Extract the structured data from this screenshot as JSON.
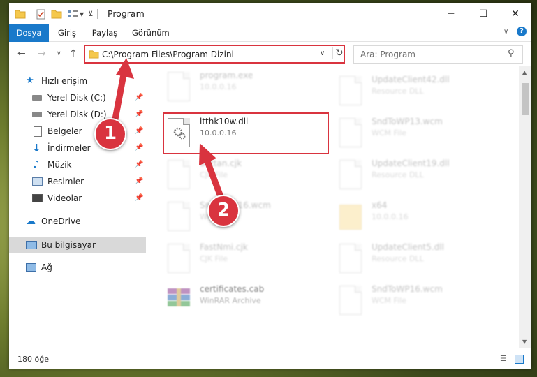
{
  "window": {
    "title": "Program",
    "minimize_icon": "─",
    "maximize_icon": "☐",
    "close_icon": "✕"
  },
  "ribbon": {
    "tabs": [
      "Dosya",
      "Giriş",
      "Paylaş",
      "Görünüm"
    ]
  },
  "address": {
    "path": "C:\\Program Files\\Program Dizini"
  },
  "search": {
    "placeholder": "Ara: Program"
  },
  "sidebar": {
    "items": [
      {
        "label": "Hızlı erişim",
        "icon": "star-icon",
        "pinned": false
      },
      {
        "label": "Yerel Disk (C:)",
        "icon": "drive-icon",
        "pinned": true
      },
      {
        "label": "Yerel Disk (D:)",
        "icon": "drive-icon",
        "pinned": true
      },
      {
        "label": "Belgeler",
        "icon": "document-icon",
        "pinned": true
      },
      {
        "label": "İndirmeler",
        "icon": "download-icon",
        "pinned": true
      },
      {
        "label": "Müzik",
        "icon": "music-icon",
        "pinned": true
      },
      {
        "label": "Resimler",
        "icon": "pictures-icon",
        "pinned": true
      },
      {
        "label": "Videolar",
        "icon": "video-icon",
        "pinned": true
      },
      {
        "label": "OneDrive",
        "icon": "cloud-icon",
        "pinned": false
      },
      {
        "label": "Bu bilgisayar",
        "icon": "computer-icon",
        "pinned": false,
        "selected": true
      },
      {
        "label": "Ağ",
        "icon": "network-icon",
        "pinned": false
      }
    ]
  },
  "files": {
    "left": [
      {
        "name": "program.exe",
        "sub": "10.0.0.16"
      },
      {
        "name": "ltthk10w.dll",
        "sub": "10.0.0.16"
      },
      {
        "name": "Settan.cjk",
        "sub": "CJK File"
      },
      {
        "name": "SndToWP16.wcm",
        "sub": "WCM File"
      },
      {
        "name": "FastNmi.cjk",
        "sub": "CJK File"
      },
      {
        "name": "certificates.cab",
        "sub": "WinRAR Archive"
      }
    ],
    "right": [
      {
        "name": "UpdateClient42.dll",
        "sub": "Resource DLL"
      },
      {
        "name": "SndToWP13.wcm",
        "sub": "WCM File"
      },
      {
        "name": "UpdateClient19.dll",
        "sub": "Resource DLL"
      },
      {
        "name": "x64",
        "sub": "10.0.0.16"
      },
      {
        "name": "UpdateClient5.dll",
        "sub": "Resource DLL"
      },
      {
        "name": "SndToWP16.wcm",
        "sub": "WCM File"
      }
    ]
  },
  "status": {
    "item_count": "180 öğe"
  },
  "annotations": {
    "step1": "1",
    "step2": "2",
    "color": "#d9343f"
  }
}
